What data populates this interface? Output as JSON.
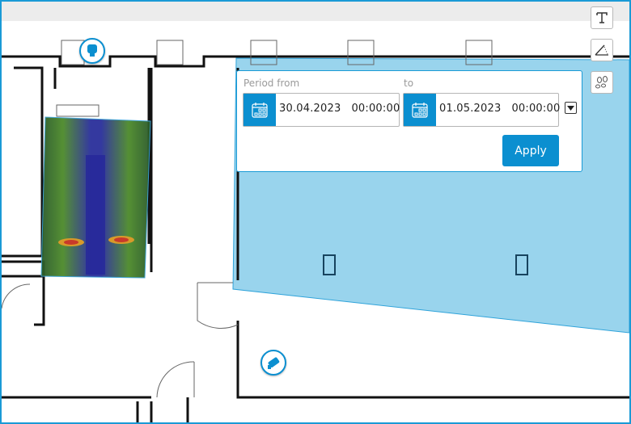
{
  "toolbar": {
    "items": [
      {
        "icon": "text-tool-icon"
      },
      {
        "icon": "angle-measure-icon"
      },
      {
        "icon": "footsteps-icon"
      }
    ]
  },
  "period": {
    "from_label": "Period from",
    "to_label": "to",
    "from_date": "30.04.2023",
    "from_time": "00:00:00",
    "to_date": "01.05.2023",
    "to_time": "00:00:00",
    "apply_label": "Apply"
  },
  "colors": {
    "accent": "#0b8fd0",
    "zone": "#8fd0ec"
  }
}
